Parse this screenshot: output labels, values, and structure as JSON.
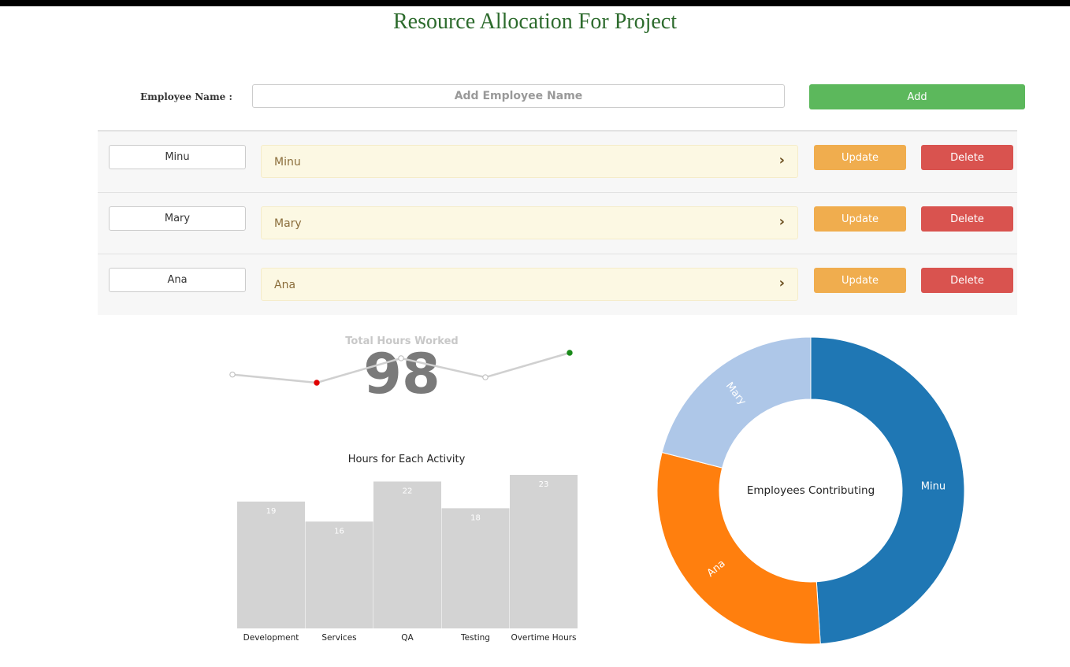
{
  "header": {
    "title": "Resource Allocation For Project"
  },
  "form": {
    "label": "Employee Name :",
    "placeholder": "Add Employee Name",
    "add_label": "Add"
  },
  "rows": [
    {
      "input_value": "Minu",
      "panel_text": "Minu",
      "update_label": "Update",
      "delete_label": "Delete"
    },
    {
      "input_value": "Mary",
      "panel_text": "Mary",
      "update_label": "Update",
      "delete_label": "Delete"
    },
    {
      "input_value": "Ana",
      "panel_text": "Ana",
      "update_label": "Update",
      "delete_label": "Delete"
    }
  ],
  "kpi": {
    "title": "Total Hours Worked",
    "value": "98",
    "sparkline": [
      {
        "value": 3,
        "color": "#ffffff"
      },
      {
        "value": 0,
        "color": "#e00000"
      },
      {
        "value": 9,
        "color": "#ffffff"
      },
      {
        "value": 2,
        "color": "#ffffff"
      },
      {
        "value": 11,
        "color": "#1a8a1a"
      }
    ]
  },
  "chart_data": [
    {
      "type": "bar",
      "title": "Hours for Each Activity",
      "categories": [
        "Development",
        "Services",
        "QA",
        "Testing",
        "Overtime Hours"
      ],
      "values": [
        19,
        16,
        22,
        18,
        23
      ],
      "ylim": [
        0,
        23
      ],
      "color": "#d3d3d3",
      "grid": false
    },
    {
      "type": "pie",
      "hole": true,
      "center_label": "Employees Contributing",
      "labels": [
        "Minu",
        "Ana",
        "Mary"
      ],
      "values": [
        49,
        30,
        21
      ],
      "colors": [
        "#1f77b4",
        "#ff7f0e",
        "#aec7e8"
      ]
    }
  ]
}
